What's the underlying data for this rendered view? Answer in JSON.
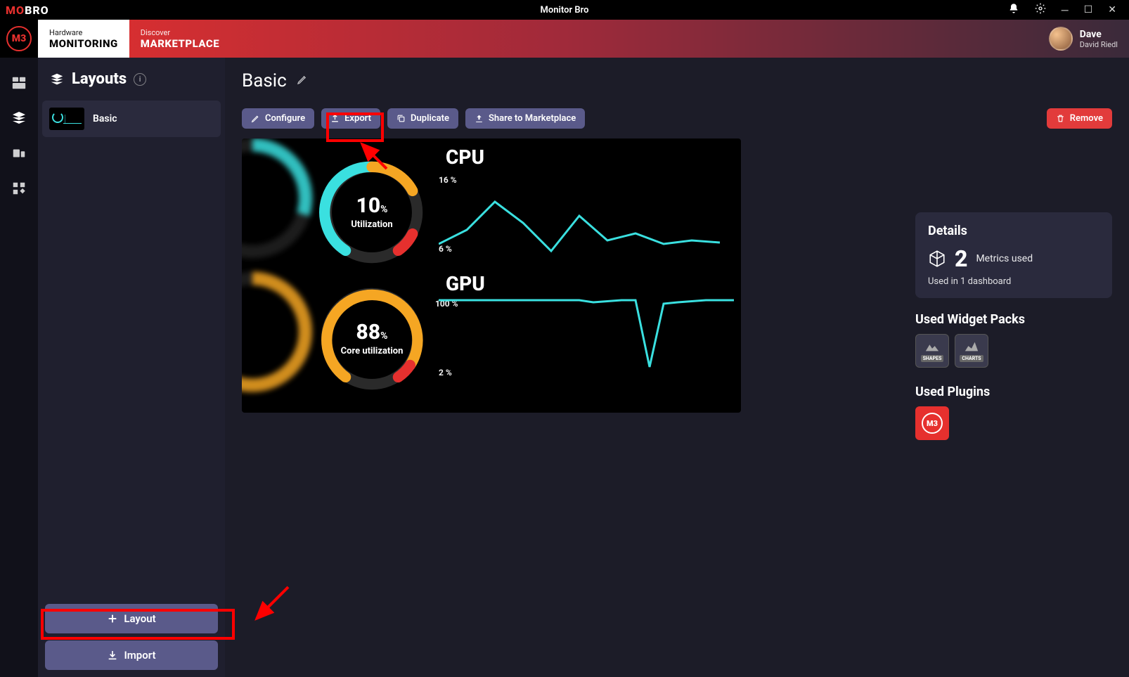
{
  "app": {
    "brand_mo": "MO",
    "brand_bro": "BRO",
    "title": "Monitor Bro"
  },
  "nav": {
    "tab1_small": "Hardware",
    "tab1_big": "MONITORING",
    "tab2_small": "Discover",
    "tab2_big": "MARKETPLACE"
  },
  "user": {
    "name": "Dave",
    "full": "David Riedl"
  },
  "side": {
    "title": "Layouts",
    "item_name": "Basic",
    "btn_layout": "Layout",
    "btn_import": "Import"
  },
  "content": {
    "title": "Basic",
    "btn_configure": "Configure",
    "btn_export": "Export",
    "btn_duplicate": "Duplicate",
    "btn_share": "Share to Marketplace",
    "btn_remove": "Remove"
  },
  "preview": {
    "cpu_title": "CPU",
    "cpu_val": "10",
    "cpu_pct": "%",
    "cpu_name": "Utilization",
    "cpu_max": "16 %",
    "cpu_min": "6 %",
    "gpu_title": "GPU",
    "gpu_val": "88",
    "gpu_pct": "%",
    "gpu_name": "Core utilization",
    "gpu_max": "100 %",
    "gpu_min": "2 %"
  },
  "details": {
    "title": "Details",
    "metrics_num": "2",
    "metrics_lbl": "Metrics used",
    "used_in": "Used in 1 dashboard",
    "packs_title": "Used Widget Packs",
    "pack1": "SHAPES",
    "pack2": "CHARTS",
    "plugins_title": "Used Plugins"
  }
}
